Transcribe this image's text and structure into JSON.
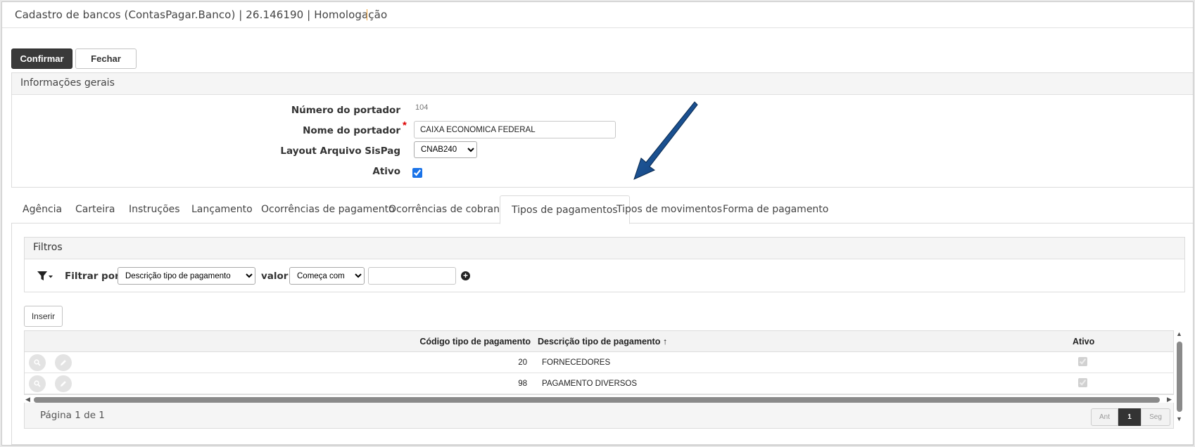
{
  "header": {
    "title": "Cadastro de bancos (ContasPagar.Banco) | 26.146190 | Homologação"
  },
  "actions": {
    "confirm_label": "Confirmar",
    "close_label": "Fechar"
  },
  "general_info": {
    "title": "Informações gerais",
    "fields": {
      "numero_label": "Número do portador",
      "numero_value": "104",
      "nome_label": "Nome do portador",
      "nome_value": "CAIXA ECONOMICA FEDERAL",
      "layout_label": "Layout Arquivo SisPag",
      "layout_value": "CNAB240",
      "ativo_label": "Ativo",
      "ativo_checked": true
    }
  },
  "tabs": [
    {
      "label": "Agência",
      "active": false
    },
    {
      "label": "Carteira",
      "active": false
    },
    {
      "label": "Instruções",
      "active": false
    },
    {
      "label": "Lançamento",
      "active": false
    },
    {
      "label": "Ocorrências de pagamento",
      "active": false
    },
    {
      "label": "Ocorrências de cobranças",
      "active": false
    },
    {
      "label": "Tipos de pagamentos",
      "active": true
    },
    {
      "label": "Tipos de movimentos",
      "active": false
    },
    {
      "label": "Forma de pagamento",
      "active": false
    }
  ],
  "filters": {
    "title": "Filtros",
    "filter_by_label": "Filtrar por",
    "field_value": "Descrição tipo de pagamento",
    "value_label": "valor",
    "operator_value": "Começa com",
    "text_value": ""
  },
  "insert_label": "Inserir",
  "grid": {
    "columns": {
      "code": "Código tipo de pagamento",
      "description": "Descrição tipo de pagamento",
      "description_sort_indicator": "↑",
      "active": "Ativo"
    },
    "rows": [
      {
        "code": "20",
        "description": "FORNECEDORES",
        "active": true
      },
      {
        "code": "98",
        "description": "PAGAMENTO DIVERSOS",
        "active": true
      }
    ]
  },
  "pager": {
    "info": "Página 1 de 1",
    "prev_label": "Ant",
    "current_page": "1",
    "next_label": "Seg"
  },
  "colors": {
    "primary_button": "#3a3a3a",
    "annotation_arrow": "#0d3d7a"
  },
  "icons": {
    "filter": "funnel-icon",
    "add_filter": "plus-circle-icon",
    "view": "magnifier-icon",
    "edit": "pencil-icon"
  }
}
